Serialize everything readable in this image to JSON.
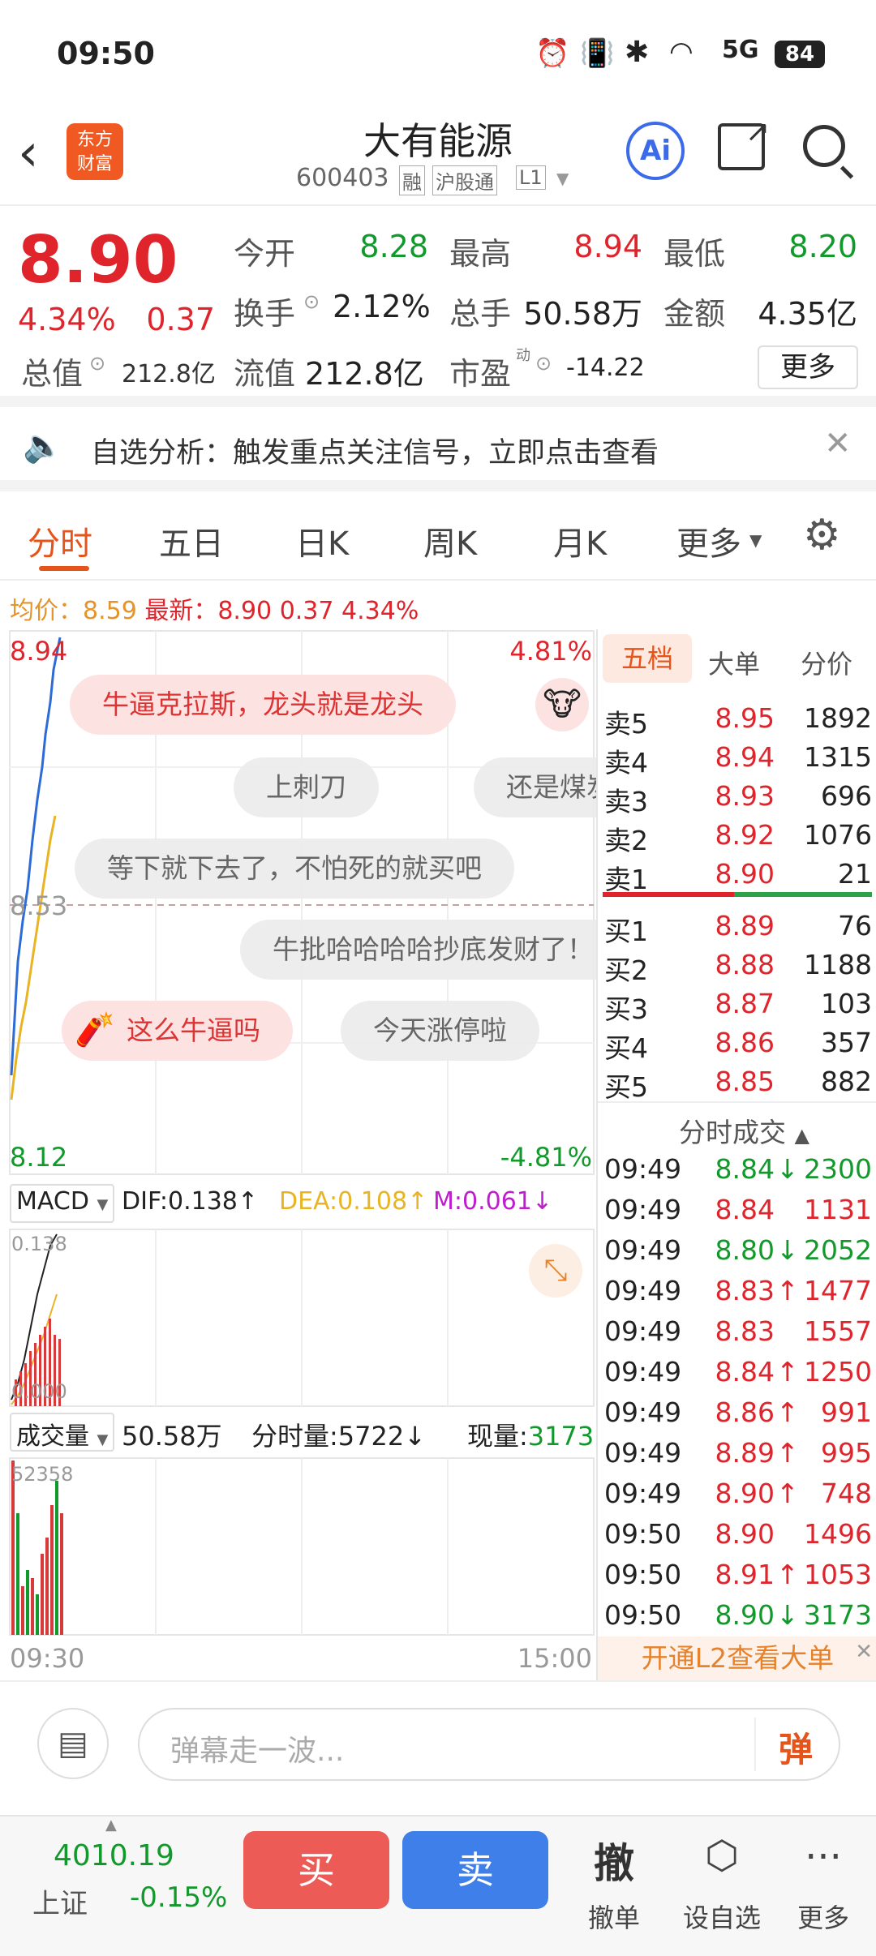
{
  "status": {
    "time": "09:50",
    "battery": "84",
    "signal": "5G"
  },
  "header": {
    "title": "大有能源",
    "code": "600403",
    "tags": [
      "融",
      "沪股通",
      "L1"
    ],
    "logo": "东方\n财富",
    "ai": "Ai"
  },
  "quote": {
    "price": "8.90",
    "pct": "4.34%",
    "change": "0.37",
    "open_label": "今开",
    "open": "8.28",
    "high_label": "最高",
    "high": "8.94",
    "low_label": "最低",
    "low": "8.20",
    "turnover_label": "换手",
    "turnover": "2.12%",
    "vol_label": "总手",
    "vol": "50.58万",
    "amount_label": "金额",
    "amount": "4.35亿",
    "mcap_label": "总值",
    "mcap": "212.8亿",
    "float_label": "流值",
    "float": "212.8亿",
    "pe_label": "市盈",
    "pe_sup": "动",
    "pe": "-14.22",
    "more": "更多"
  },
  "alert": {
    "text": "自选分析：触发重点关注信号，立即点击查看"
  },
  "tabs": [
    "分时",
    "五日",
    "日K",
    "周K",
    "月K",
    "更多"
  ],
  "summary": {
    "avg_label": "均价：",
    "avg": "8.59",
    "latest_label": "最新：",
    "latest": "8.90",
    "chg": "0.37",
    "pct": "4.34%"
  },
  "chart": {
    "top_price": "8.94",
    "top_pct": "4.81%",
    "mid_price": "8.53",
    "bottom_price": "8.12",
    "bottom_pct": "-4.81%",
    "start_time": "09:30",
    "end_time": "15:00",
    "macd": {
      "label": "MACD",
      "dif": "DIF:0.138↑",
      "dea": "DEA:0.108↑",
      "m": "M:0.061↓",
      "axis_top": "0.138",
      "axis_bottom": "0.000"
    },
    "volume": {
      "label": "成交量",
      "total": "50.58万",
      "tick": "分时量:5722↓",
      "now_label": "现量:",
      "now": "3173",
      "axis_top": "52358"
    }
  },
  "danmu": [
    {
      "text": "牛逼克拉斯，龙头就是龙头",
      "hot": true
    },
    {
      "text": "上刺刀",
      "hot": false
    },
    {
      "text": "还是煤炭",
      "hot": false
    },
    {
      "text": "等下就下去了，不怕死的就买吧",
      "hot": false
    },
    {
      "text": "牛批哈哈哈哈抄底发财了！",
      "hot": false
    },
    {
      "text": "这么牛逼吗",
      "hot": true
    },
    {
      "text": "今天涨停啦",
      "hot": false
    }
  ],
  "book": {
    "tabs": [
      "五档",
      "大单",
      "分价"
    ],
    "asks": [
      {
        "l": "卖5",
        "p": "8.95",
        "v": "1892"
      },
      {
        "l": "卖4",
        "p": "8.94",
        "v": "1315"
      },
      {
        "l": "卖3",
        "p": "8.93",
        "v": "696"
      },
      {
        "l": "卖2",
        "p": "8.92",
        "v": "1076"
      },
      {
        "l": "卖1",
        "p": "8.90",
        "v": "21"
      }
    ],
    "bids": [
      {
        "l": "买1",
        "p": "8.89",
        "v": "76"
      },
      {
        "l": "买2",
        "p": "8.88",
        "v": "1188"
      },
      {
        "l": "买3",
        "p": "8.87",
        "v": "103"
      },
      {
        "l": "买4",
        "p": "8.86",
        "v": "357"
      },
      {
        "l": "买5",
        "p": "8.85",
        "v": "882"
      }
    ],
    "trades_title": "分时成交",
    "trades": [
      {
        "t": "09:49",
        "p": "8.84",
        "d": "↓",
        "v": "2300",
        "c": "green"
      },
      {
        "t": "09:49",
        "p": "8.84",
        "d": "",
        "v": "1131",
        "c": "red"
      },
      {
        "t": "09:49",
        "p": "8.80",
        "d": "↓",
        "v": "2052",
        "c": "green"
      },
      {
        "t": "09:49",
        "p": "8.83",
        "d": "↑",
        "v": "1477",
        "c": "red"
      },
      {
        "t": "09:49",
        "p": "8.83",
        "d": "",
        "v": "1557",
        "c": "red"
      },
      {
        "t": "09:49",
        "p": "8.84",
        "d": "↑",
        "v": "1250",
        "c": "red"
      },
      {
        "t": "09:49",
        "p": "8.86",
        "d": "↑",
        "v": "991",
        "c": "red"
      },
      {
        "t": "09:49",
        "p": "8.89",
        "d": "↑",
        "v": "995",
        "c": "red"
      },
      {
        "t": "09:49",
        "p": "8.90",
        "d": "↑",
        "v": "748",
        "c": "red"
      },
      {
        "t": "09:50",
        "p": "8.90",
        "d": "",
        "v": "1496",
        "c": "red"
      },
      {
        "t": "09:50",
        "p": "8.91",
        "d": "↑",
        "v": "1053",
        "c": "red"
      },
      {
        "t": "09:50",
        "p": "8.90",
        "d": "↓",
        "v": "3173",
        "c": "green"
      }
    ],
    "l2": "开通L2查看大单"
  },
  "input": {
    "placeholder": "弹幕走一波...",
    "send": "弹"
  },
  "bottom": {
    "index_value": "4010.19",
    "index_name": "上证",
    "index_pct": "-0.15%",
    "buy": "买",
    "sell": "卖",
    "cancel_icon": "撤",
    "cancel": "撤单",
    "watch": "设自选",
    "more": "更多"
  }
}
